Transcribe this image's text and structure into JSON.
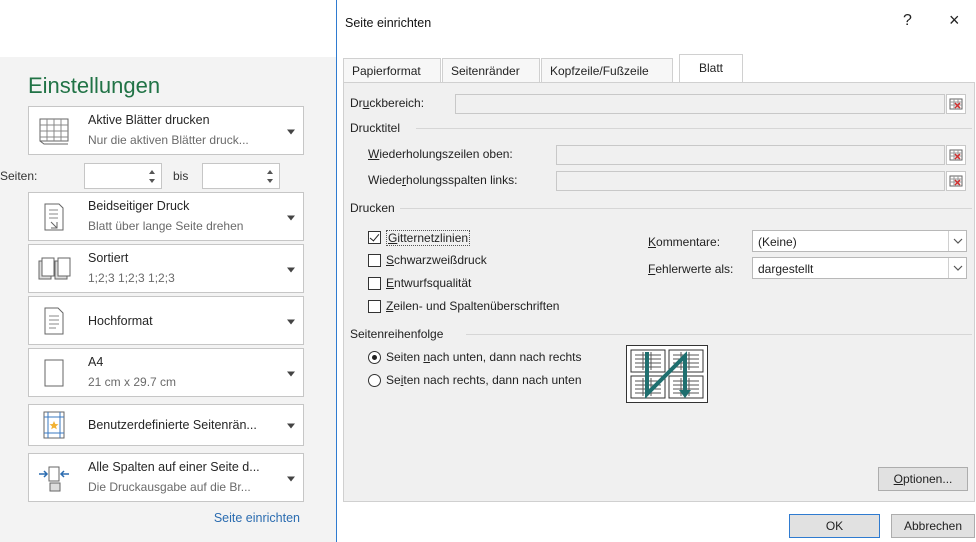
{
  "settings": {
    "title": "Einstellungen",
    "print_active": {
      "title": "Aktive Blätter drucken",
      "subtitle": "Nur die aktiven Blätter druck..."
    },
    "pages": {
      "label": "Seiten:",
      "from_value": "",
      "to_label": "bis",
      "to_value": ""
    },
    "duplex": {
      "title": "Beidseitiger Druck",
      "subtitle": "Blatt über lange Seite drehen"
    },
    "collate": {
      "title": "Sortiert",
      "subtitle": "1;2;3   1;2;3   1;2;3"
    },
    "orientation": {
      "title": "Hochformat"
    },
    "paper": {
      "title": "A4",
      "subtitle": "21 cm x 29.7 cm"
    },
    "margins": {
      "title": "Benutzerdefinierte Seitenrän..."
    },
    "scaling": {
      "title": "Alle Spalten auf einer Seite d...",
      "subtitle": "Die Druckausgabe auf die Br..."
    },
    "page_setup_link": "Seite einrichten"
  },
  "dialog": {
    "title": "Seite einrichten",
    "help": "?",
    "close": "×",
    "tabs": [
      {
        "label": "Papierformat"
      },
      {
        "label": "Seitenränder"
      },
      {
        "label": "Kopfzeile/Fußzeile"
      },
      {
        "label": "Blatt"
      }
    ],
    "active_tab": "Blatt",
    "print_area": {
      "pre": "Dr",
      "key": "u",
      "post": "ckbereich:",
      "value": ""
    },
    "print_titles": {
      "heading": "Drucktitel",
      "rows": {
        "key": "W",
        "post": "iederholungszeilen oben:",
        "value": ""
      },
      "cols": {
        "pre": "Wiede",
        "key": "r",
        "post": "holungsspalten links:",
        "value": ""
      }
    },
    "print": {
      "heading": "Drucken",
      "gridlines": {
        "key": "G",
        "post": "itternetzlinien",
        "checked": true
      },
      "bw": {
        "key": "S",
        "post": "chwarzweißdruck",
        "checked": false
      },
      "draft": {
        "key": "E",
        "post": "ntwurfsqualität",
        "checked": false
      },
      "headings": {
        "key": "Z",
        "post": "eilen- und Spaltenüberschriften",
        "checked": false
      },
      "comments": {
        "key": "K",
        "post": "ommentare:",
        "value": "(Keine)"
      },
      "errors": {
        "key": "F",
        "post": "ehlerwerte als:",
        "value": "dargestellt"
      }
    },
    "page_order": {
      "heading": "Seitenreihenfolge",
      "down_then_over": {
        "pre": "Seiten ",
        "key": "n",
        "post": "ach unten, dann nach rechts",
        "selected": true
      },
      "over_then_down": {
        "pre": "Se",
        "key": "i",
        "post": "ten nach rechts, dann nach unten",
        "selected": false
      }
    },
    "options_button": {
      "key": "O",
      "post": "ptionen..."
    },
    "ok_button": "OK",
    "cancel_button": "Abbrechen"
  },
  "colors": {
    "accent": "#217346",
    "link": "#2b6cb0",
    "dialog_border": "#2f7bd0",
    "arrow": "#1f6f6f"
  }
}
